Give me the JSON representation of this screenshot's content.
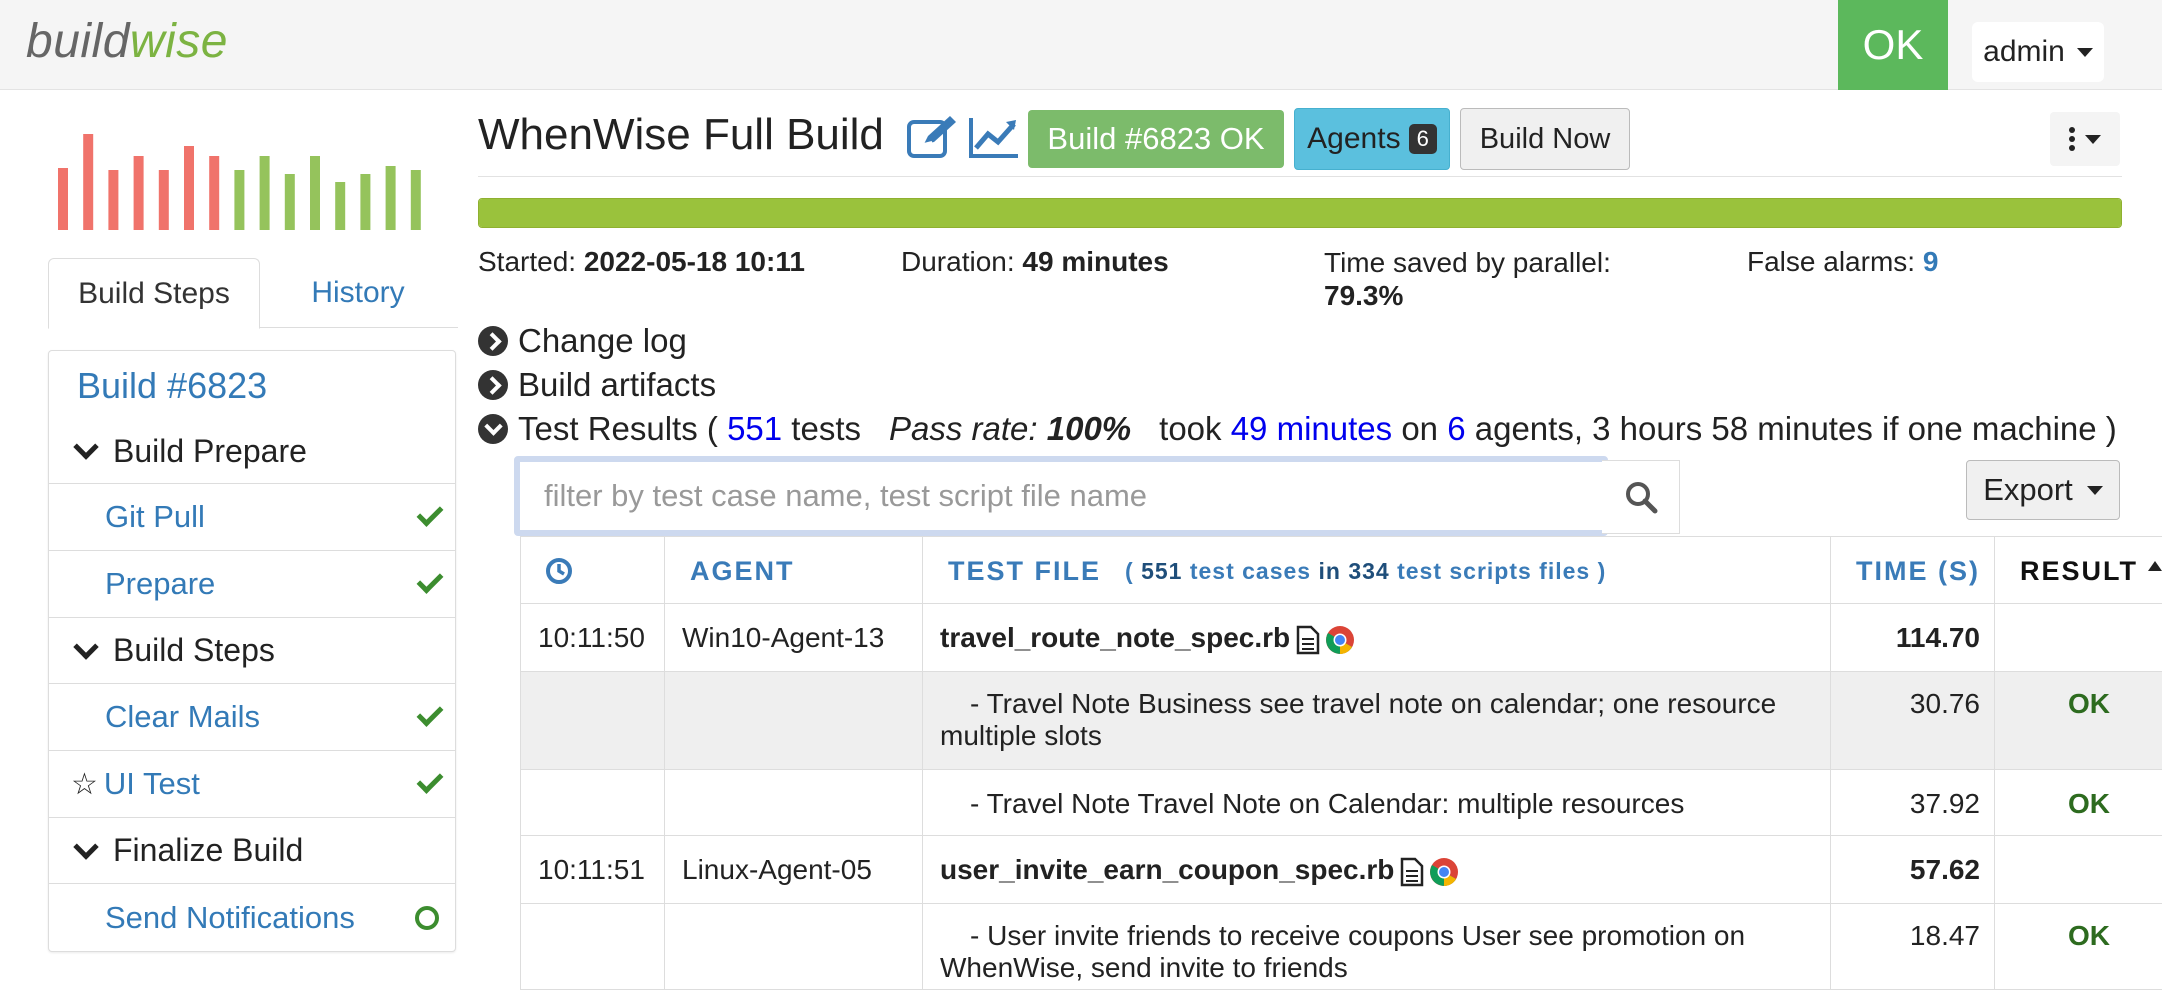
{
  "brand": {
    "part1": "build",
    "part2": "wise"
  },
  "nav": {
    "status": "OK",
    "user": "admin"
  },
  "sparkline": {
    "values": [
      0.62,
      0.96,
      0.6,
      0.74,
      0.6,
      0.84,
      0.74,
      0.6,
      0.74,
      0.56,
      0.74,
      0.48,
      0.56,
      0.64,
      0.6,
      0.64
    ],
    "fail_count": 7,
    "colors": {
      "fail": "#f0736b",
      "pass": "#95c35c"
    }
  },
  "tabs": {
    "build_steps": "Build Steps",
    "history": "History"
  },
  "steps": {
    "build_link": "Build #6823",
    "items": [
      {
        "type": "group",
        "label": "Build Prepare"
      },
      {
        "type": "step",
        "label": "Git Pull",
        "status": "done"
      },
      {
        "type": "step",
        "label": "Prepare",
        "status": "done"
      },
      {
        "type": "group",
        "label": "Build Steps"
      },
      {
        "type": "step",
        "label": "Clear Mails",
        "status": "done"
      },
      {
        "type": "step",
        "label": "UI Test",
        "status": "done",
        "starred": true
      },
      {
        "type": "group",
        "label": "Finalize Build"
      },
      {
        "type": "step",
        "label": "Send Notifications",
        "status": "pending"
      }
    ]
  },
  "header": {
    "title": "WhenWise Full Build",
    "build_badge": "Build #6823 OK",
    "agents_label": "Agents",
    "agents_count": "6",
    "build_now": "Build Now"
  },
  "progress": {
    "percent": 100
  },
  "stats": {
    "started_label": "Started:",
    "started_value": "2022-05-18 10:11",
    "duration_label": "Duration:",
    "duration_value": "49 minutes",
    "time_saved_label": "Time saved by parallel:",
    "time_saved_value": "79.3%",
    "false_alarms_label": "False alarms:",
    "false_alarms_value": "9"
  },
  "sections": {
    "change_log": "Change log",
    "build_artifacts": "Build artifacts",
    "test_results": {
      "prefix": "Test Results (",
      "tests_count": "551",
      "tests_word": "tests",
      "pass_rate_label": "Pass rate:",
      "pass_rate_value": "100%",
      "took": "took",
      "took_value": "49 minutes",
      "on": "on",
      "agents_value": "6",
      "suffix": "agents, 3 hours 58 minutes if one machine )"
    }
  },
  "filter": {
    "placeholder": "filter by test case name, test script file name"
  },
  "export": {
    "label": "Export"
  },
  "table": {
    "headers": {
      "agent": "AGENT",
      "test_file": "TEST FILE",
      "test_file_note_open": "(",
      "test_cases_count": "551",
      "test_cases_word": "test cases",
      "in_word": "in",
      "scripts_count": "334",
      "scripts_word": "test scripts files",
      "test_file_note_close": ")",
      "time": "TIME (S)",
      "result": "RESULT"
    },
    "rows": [
      {
        "kind": "file",
        "time_of_day": "10:11:50",
        "agent": "Win10-Agent-13",
        "name": "travel_route_note_spec.rb",
        "duration": "114.70",
        "result": ""
      },
      {
        "kind": "case",
        "name": "- Travel Note Business see travel note on calendar; one resource multiple slots",
        "duration": "30.76",
        "result": "OK",
        "shaded": true
      },
      {
        "kind": "case",
        "name": "- Travel Note Travel Note on Calendar: multiple resources",
        "duration": "37.92",
        "result": "OK"
      },
      {
        "kind": "file",
        "time_of_day": "10:11:51",
        "agent": "Linux-Agent-05",
        "name": "user_invite_earn_coupon_spec.rb",
        "duration": "57.62",
        "result": ""
      },
      {
        "kind": "case",
        "name": "- User invite friends to receive coupons User see promotion on WhenWise, send invite to friends",
        "duration": "18.47",
        "result": "OK"
      }
    ]
  }
}
